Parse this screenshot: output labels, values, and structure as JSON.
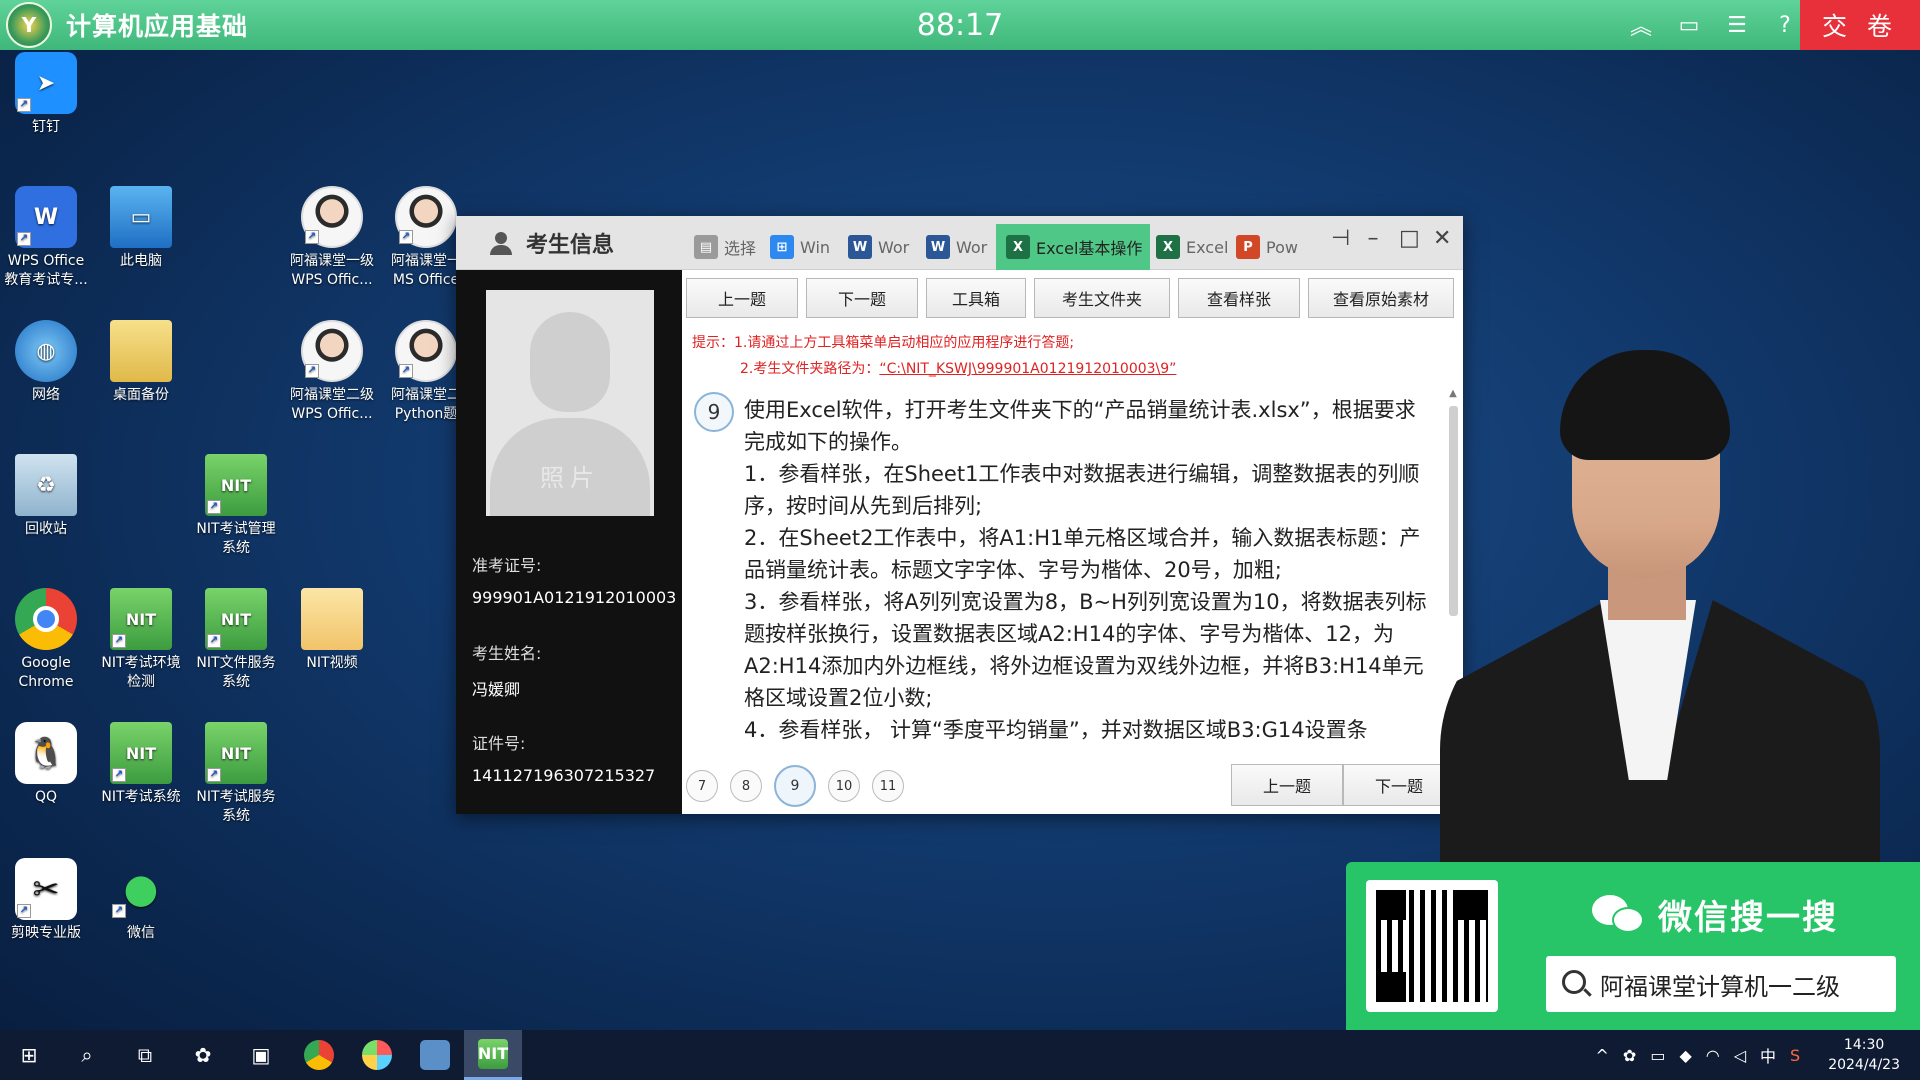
{
  "topbar": {
    "title": "计算机应用基础",
    "timer": "88:17",
    "submit_label": "交 卷",
    "icons": [
      "collapse-up-icon",
      "window-icon",
      "list-icon",
      "help-icon"
    ]
  },
  "desktop": {
    "icons": [
      {
        "label": "钉钉",
        "icon": "dingtalk-icon"
      },
      {
        "label": "WPS Office\n教育考试专...",
        "icon": "wps-icon"
      },
      {
        "label": "此电脑",
        "icon": "computer-icon"
      },
      {
        "label": "阿福课堂一级\nWPS Offic...",
        "icon": "avatar-icon"
      },
      {
        "label": "阿福课堂一\nMS Office",
        "icon": "avatar-icon"
      },
      {
        "label": "网络",
        "icon": "network-icon"
      },
      {
        "label": "桌面备份",
        "icon": "folder-icon"
      },
      {
        "label": "阿福课堂二级\nWPS Offic...",
        "icon": "avatar-icon"
      },
      {
        "label": "阿福课堂二\nPython题",
        "icon": "avatar-icon"
      },
      {
        "label": "回收站",
        "icon": "recycle-bin-icon"
      },
      {
        "label": "NIT考试管理\n系统",
        "icon": "nit-icon"
      },
      {
        "label": "Google\nChrome",
        "icon": "chrome-icon"
      },
      {
        "label": "NIT考试环境\n检测",
        "icon": "nit-icon"
      },
      {
        "label": "NIT文件服务\n系统",
        "icon": "nit-icon"
      },
      {
        "label": "NIT视频",
        "icon": "folder-icon"
      },
      {
        "label": "QQ",
        "icon": "qq-icon"
      },
      {
        "label": "NIT考试系统",
        "icon": "nit-icon"
      },
      {
        "label": "NIT考试服务\n系统",
        "icon": "nit-icon"
      },
      {
        "label": "剪映专业版",
        "icon": "capcut-icon"
      },
      {
        "label": "微信",
        "icon": "wechat-icon"
      }
    ]
  },
  "window": {
    "candidate_title": "考生信息",
    "tabs": [
      {
        "label": "选择",
        "icon": "doc-icon",
        "color": "#9a9a9a"
      },
      {
        "label": "Win",
        "icon": "windows-icon",
        "color": "#2d89ef"
      },
      {
        "label": "Wor",
        "icon": "word-icon",
        "color": "#2b5797"
      },
      {
        "label": "Wor",
        "icon": "word-icon",
        "color": "#2b5797"
      },
      {
        "label": "Excel基本操作",
        "icon": "excel-icon",
        "color": "#1e7145",
        "active": true
      },
      {
        "label": "Excel",
        "icon": "excel-icon",
        "color": "#1e7145"
      },
      {
        "label": "Pow",
        "icon": "powerpoint-icon",
        "color": "#d24726"
      }
    ],
    "controls": [
      "pin-icon",
      "minimize-icon",
      "maximize-icon",
      "close-icon"
    ],
    "candidate": {
      "photo_label": "照片",
      "ticket_label": "准考证号:",
      "ticket_value": "999901A0121912010003",
      "name_label": "考生姓名:",
      "name_value": "冯媛卿",
      "id_label": "证件号:",
      "id_value": "141127196307215327"
    },
    "toolbar": {
      "prev": "上一题",
      "next": "下一题",
      "toolbox": "工具箱",
      "folder": "考生文件夹",
      "sample": "查看样张",
      "original": "查看原始素材"
    },
    "hint": {
      "line1": "提示：1.请通过上方工具箱菜单启动相应的应用程序进行答题;",
      "line2_prefix": "2.考生文件夹路径为：",
      "line2_path": "“C:\\NIT_KSWJ\\999901A0121912010003\\9”"
    },
    "question": {
      "number": "9",
      "paragraphs": [
        "使用Excel软件，打开考生文件夹下的“产品销量统计表.xlsx”，根据要求完成如下的操作。",
        "1．参看样张，在Sheet1工作表中对数据表进行编辑，调整数据表的列顺序，按时间从先到后排列;",
        "2．在Sheet2工作表中，将A1:H1单元格区域合并，输入数据表标题：产品销量统计表。标题文字字体、字号为楷体、20号，加粗;",
        "3．参看样张，将A列列宽设置为8，B~H列列宽设置为10，将数据表列标题按样张换行，设置数据表区域A2:H14的字体、字号为楷体、12，为A2:H14添加内外边框线，将外边框设置为双线外边框，并将B3:H14单元格区域设置2位小数;",
        "4．参看样张， 计算“季度平均销量”，并对数据区域B3:G14设置条"
      ]
    },
    "pager": [
      "7",
      "8",
      "9",
      "10",
      "11"
    ],
    "current_page": "9",
    "bottom_prev": "上一题",
    "bottom_next": "下一题"
  },
  "promo": {
    "title": "微信搜一搜",
    "search_text": "阿福课堂计算机一二级"
  },
  "taskbar": {
    "apps": [
      "start-icon",
      "search-icon",
      "task-view-icon",
      "pinwheel-icon",
      "monitor-app-icon",
      "chrome-icon",
      "browser-icon",
      "explorer-window-icon",
      "nit-icon"
    ],
    "tray_ime": "中",
    "time": "14:30",
    "date": "2024/4/23"
  },
  "colors": {
    "topbar": "#3fb77a",
    "submit": "#e8303a",
    "active_tab": "#4fc887",
    "hint": "#e02222",
    "promo": "#27c568"
  }
}
